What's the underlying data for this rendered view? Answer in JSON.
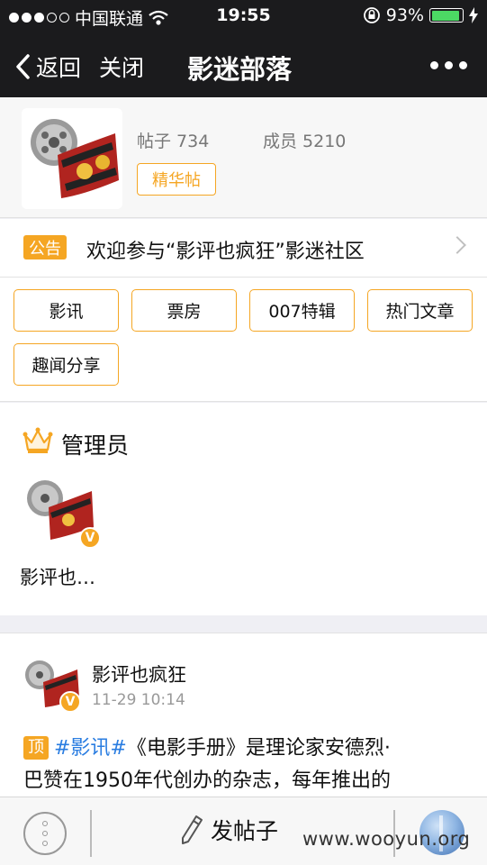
{
  "status_bar": {
    "carrier": "中国联通",
    "time": "19:55",
    "battery_percent": "93%",
    "battery_level": 0.93
  },
  "nav": {
    "back_label": "返回",
    "close_label": "关闭",
    "title": "影迷部落"
  },
  "header": {
    "posts_label": "帖子 734",
    "members_label": "成员 5210",
    "essence_label": "精华帖"
  },
  "notice": {
    "badge": "公告",
    "text": "欢迎参与“影评也疯狂”影迷社区"
  },
  "tags": [
    "影讯",
    "票房",
    "007特辑",
    "热门文章",
    "趣闻分享"
  ],
  "admins": {
    "title": "管理员",
    "items": [
      {
        "name": "影评也…"
      }
    ]
  },
  "post": {
    "author": "影评也疯狂",
    "time": "11-29 10:14",
    "top_badge": "顶",
    "topic": "#影讯#",
    "line1_rest": "《电影手册》是理论家安德烈·",
    "line2": "巴赞在1950年代创办的杂志，每年推出的"
  },
  "bottom_bar": {
    "post_label": "发帖子",
    "watermark": "www.wooyun.org"
  },
  "colors": {
    "accent": "#f5a623",
    "topic_link": "#2a7de1",
    "nav_bg": "#1b1b1d"
  },
  "icons": [
    "signal-icon",
    "wifi-icon",
    "lock-rotation-icon",
    "battery-icon",
    "charging-icon",
    "back-chevron-icon",
    "more-icon",
    "chevron-right-icon",
    "crown-icon",
    "verified-badge-icon",
    "menu-icon",
    "pencil-icon"
  ]
}
